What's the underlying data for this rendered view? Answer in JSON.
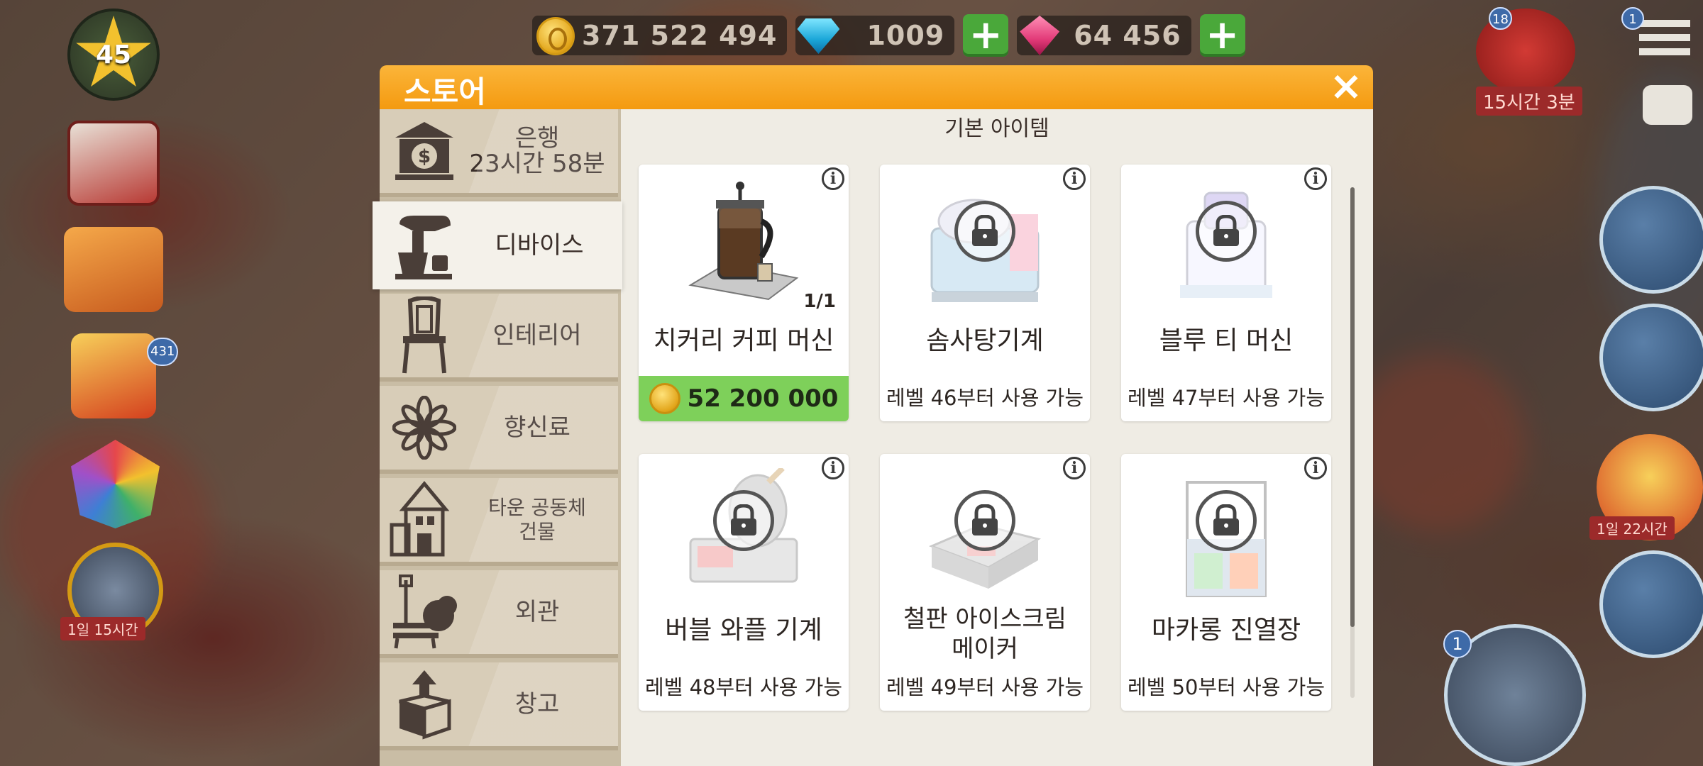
{
  "hud": {
    "level": "45",
    "coins": "371 522 494",
    "blue_gems": "1009",
    "pink_gems": "64 456",
    "left_badge_count": "431",
    "left_timer": "1일 15시간",
    "gift_badge": "18",
    "gift_timer": "15시간 3분",
    "menu_badge": "1",
    "balloon_timer": "1일 22시간",
    "register_badge": "1"
  },
  "store": {
    "title": "스토어",
    "close_label": "×",
    "section_title": "기본 아이템",
    "categories": [
      {
        "label": "은행",
        "sub": "23시간 58분",
        "icon": "bank-icon"
      },
      {
        "label": "디바이스",
        "icon": "mixer-icon",
        "active": true
      },
      {
        "label": "인테리어",
        "icon": "chair-icon"
      },
      {
        "label": "향신료",
        "icon": "anise-icon"
      },
      {
        "label": "타운 공동체",
        "sub": "건물",
        "icon": "town-building-icon"
      },
      {
        "label": "외관",
        "icon": "bench-icon"
      },
      {
        "label": "창고",
        "icon": "box-icon"
      }
    ],
    "items": [
      {
        "name": "치커리 커피 머신",
        "count": "1/1",
        "price": "52 200 000",
        "locked": false
      },
      {
        "name": "솜사탕기계",
        "requirement": "레벨 46부터 사용 가능",
        "locked": true
      },
      {
        "name": "블루 티 머신",
        "requirement": "레벨 47부터 사용 가능",
        "locked": true
      },
      {
        "name": "버블 와플 기계",
        "requirement": "레벨 48부터 사용 가능",
        "locked": true
      },
      {
        "name_line1": "철판 아이스크림",
        "name_line2": "메이커",
        "requirement": "레벨 49부터 사용 가능",
        "locked": true
      },
      {
        "name": "마카롱 진열장",
        "requirement": "레벨 50부터 사용 가능",
        "locked": true
      }
    ]
  },
  "colors": {
    "header": "#f49a10",
    "price_bg": "#7ed05a",
    "plus_button": "#4aa83a"
  }
}
